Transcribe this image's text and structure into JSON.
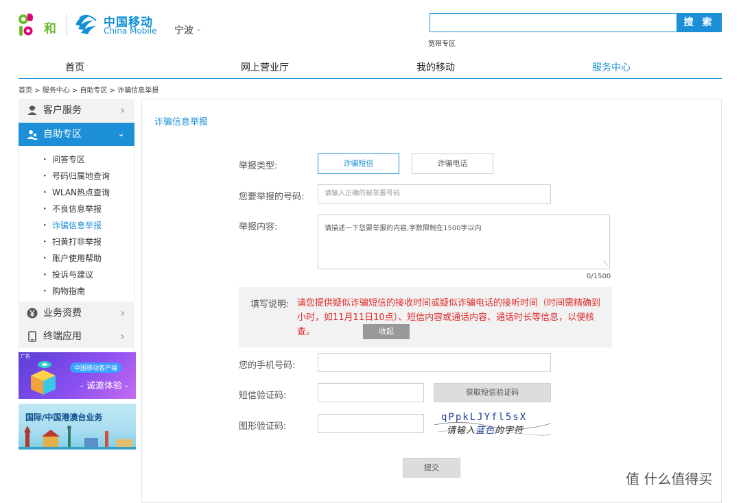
{
  "header": {
    "brand_and_suffix": "和",
    "brand_cn": "中国移动",
    "brand_en": "China Mobile",
    "city": "宁波",
    "search_placeholder": "",
    "search_button": "搜 索",
    "broadband_link": "宽带专区"
  },
  "nav": {
    "items": [
      {
        "label": "首页",
        "active": false
      },
      {
        "label": "网上营业厅",
        "active": false
      },
      {
        "label": "我的移动",
        "active": false
      },
      {
        "label": "服务中心",
        "active": true
      }
    ]
  },
  "breadcrumb": {
    "items": [
      "首页",
      "服务中心",
      "自助专区",
      "诈骗信息举报"
    ],
    "separator": ">"
  },
  "sidebar": {
    "categories": [
      {
        "label": "客户服务",
        "icon": "user-headset-icon",
        "active": false
      },
      {
        "label": "自助专区",
        "icon": "user-group-icon",
        "active": true
      },
      {
        "label": "业务资费",
        "icon": "yen-coin-icon",
        "active": false
      },
      {
        "label": "终端应用",
        "icon": "phone-device-icon",
        "active": false
      }
    ],
    "sub_items": [
      {
        "label": "问答专区",
        "active": false
      },
      {
        "label": "号码归属地查询",
        "active": false
      },
      {
        "label": "WLAN热点查询",
        "active": false
      },
      {
        "label": "不良信息举报",
        "active": false
      },
      {
        "label": "诈骗信息举报",
        "active": true
      },
      {
        "label": "扫黄打非举报",
        "active": false
      },
      {
        "label": "账户使用帮助",
        "active": false
      },
      {
        "label": "投诉与建议",
        "active": false
      },
      {
        "label": "购物指南",
        "active": false
      }
    ],
    "ads": [
      {
        "tag": "广告",
        "pill": "中国移动客户端",
        "text": "- 诚邀体验 -"
      },
      {
        "text": "国际/中国港澳台业务"
      }
    ]
  },
  "form": {
    "title": "诈骗信息举报",
    "report_type_label": "举报类型:",
    "type_options": [
      {
        "label": "诈骗短信",
        "selected": true
      },
      {
        "label": "诈骗电话",
        "selected": false
      }
    ],
    "number_label": "您要举报的号码:",
    "number_placeholder": "请输入正确的被举报号码",
    "content_label": "举报内容:",
    "content_placeholder": "请描述一下您要举报的内容,字数限制在1500字以内",
    "counter": "0/1500",
    "note_label": "填写说明:",
    "note_text": "请您提供疑似诈骗短信的接收时间或疑似诈骗电话的接听时间（时间需精确到小时，如11月11日10点）、短信内容或通话内容、通话时长等信息，以便核查。",
    "collapse_button": "收起",
    "phone_label": "您的手机号码:",
    "sms_code_label": "短信验证码:",
    "get_sms_code_button": "获取短信验证码",
    "captcha_label": "图形验证码:",
    "captcha_chars": "qPpkLJYfl5sX",
    "captcha_hint_prefix": "请输入",
    "captcha_hint_color": "蓝色",
    "captcha_hint_suffix": "的字符",
    "submit_button": "提交"
  },
  "watermark": "值 什么值得买",
  "colors": {
    "accent": "#1c8fd6",
    "warning_text": "#e02a2a",
    "panel_gray": "#f2f2f2"
  }
}
